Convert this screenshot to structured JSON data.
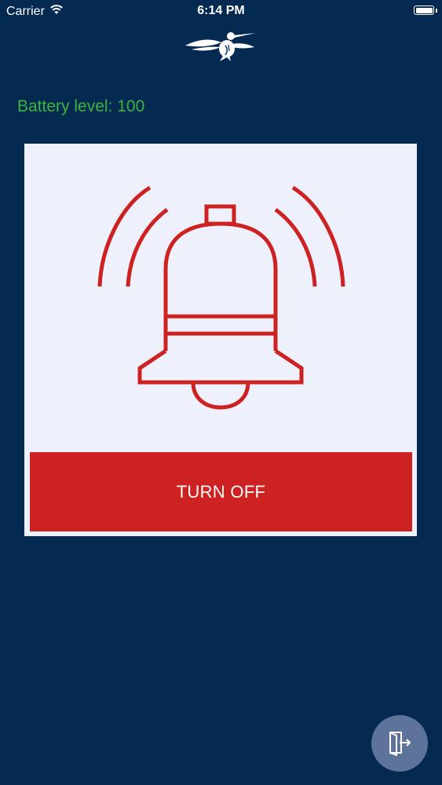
{
  "status_bar": {
    "carrier": "Carrier",
    "time": "6:14 PM",
    "icons": [
      "wifi-icon",
      "battery-icon"
    ]
  },
  "header": {
    "logo": "hummingbird-logo"
  },
  "battery": {
    "label": "Battery level: 100"
  },
  "alarm": {
    "icon": "ringing-bell-icon",
    "turn_off_label": "TURN OFF"
  },
  "exit_button": {
    "icon": "exit-door-icon"
  },
  "colors": {
    "background": "#042a52",
    "battery_text": "#3ab53e",
    "card": "#eef0fb",
    "accent_red": "#cc2222",
    "exit_button": "#5d739a"
  }
}
